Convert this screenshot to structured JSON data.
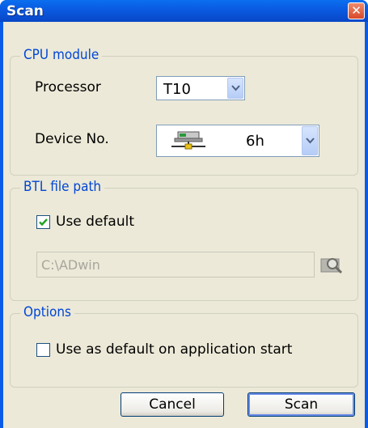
{
  "window": {
    "title": "Scan",
    "close_icon": "close-icon"
  },
  "cpu_module": {
    "label": "CPU module",
    "processor_label": "Processor",
    "processor_value": "T10",
    "device_label": "Device No.",
    "device_value": "6h",
    "device_icon": "network-device-icon"
  },
  "btl": {
    "label": "BTL file path",
    "use_default_label": "Use default",
    "use_default_checked": true,
    "path_value": "C:\\ADwin",
    "browse_icon": "search-folder-icon"
  },
  "options": {
    "label": "Options",
    "startup_label": "Use as default on application start",
    "startup_checked": false
  },
  "buttons": {
    "cancel": "Cancel",
    "scan": "Scan"
  },
  "colors": {
    "titlebar": "#0a5ae0",
    "group_label": "#0046d5",
    "dialog_bg": "#ece9d8"
  }
}
